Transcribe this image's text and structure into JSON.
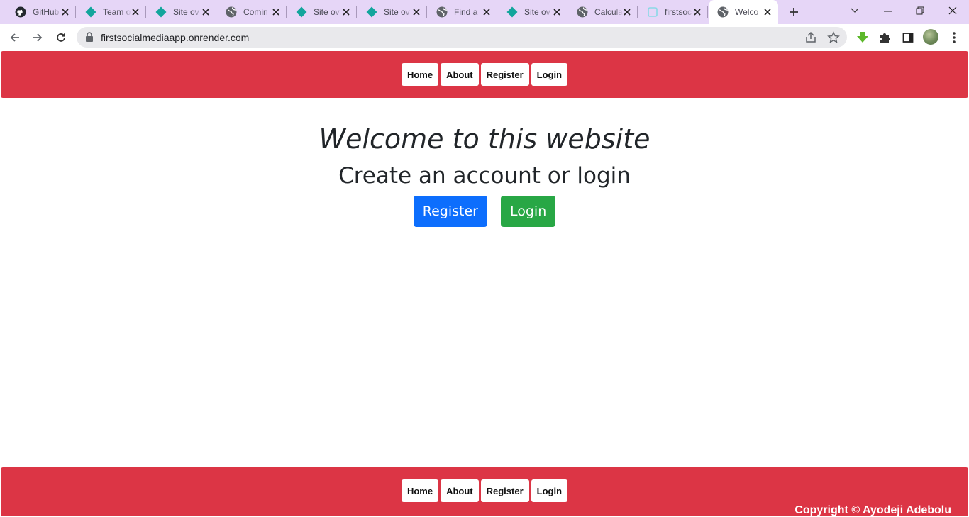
{
  "browser": {
    "tabs": [
      {
        "icon": "github-icon",
        "title": "GitHub"
      },
      {
        "icon": "diamond-icon",
        "title": "Team o"
      },
      {
        "icon": "diamond-icon",
        "title": "Site ov"
      },
      {
        "icon": "globe-icon",
        "title": "Comin"
      },
      {
        "icon": "diamond-icon",
        "title": "Site ov"
      },
      {
        "icon": "diamond-icon",
        "title": "Site ov"
      },
      {
        "icon": "globe-icon",
        "title": "Find a"
      },
      {
        "icon": "diamond-icon",
        "title": "Site ov"
      },
      {
        "icon": "globe-icon",
        "title": "Calcula"
      },
      {
        "icon": "square-icon",
        "title": "firstsoc"
      },
      {
        "icon": "globe-icon",
        "title": "Welco"
      }
    ],
    "active_tab": 10,
    "url": "firstsocialmediaapp.onrender.com",
    "colors": {
      "tabbar": "#e6d6f7",
      "diamond": "#12a59c"
    }
  },
  "site": {
    "nav": {
      "home": "Home",
      "about": "About",
      "register": "Register",
      "login": "Login"
    },
    "hero": {
      "title": "Welcome to this website",
      "subtitle": "Create an account or login",
      "register_button": "Register",
      "login_button": "Login"
    },
    "footer": {
      "copyright": "Copyright © Ayodeji Adebolu"
    },
    "colors": {
      "navbar": "#dc3545",
      "primary": "#0d6efd",
      "success": "#28a745"
    }
  }
}
